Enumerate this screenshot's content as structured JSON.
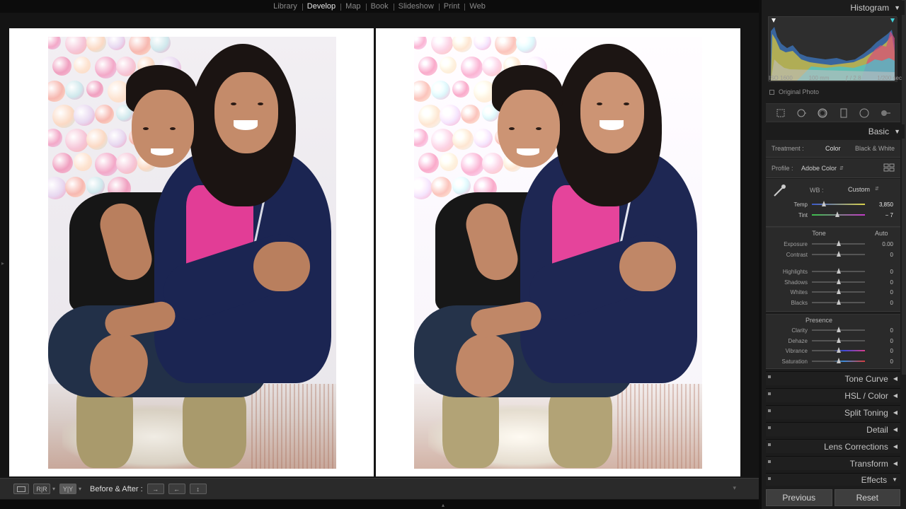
{
  "modules": [
    "Library",
    "Develop",
    "Map",
    "Book",
    "Slideshow",
    "Print",
    "Web"
  ],
  "active_module": "Develop",
  "toolbar": {
    "before_after_label": "Before & After :"
  },
  "panel": {
    "histogram_title": "Histogram",
    "iso": "ISO 1600",
    "focal": "100 mm",
    "aperture": "ƒ / 2.8",
    "shutter": "1/200 sec",
    "original_photo": "Original Photo",
    "basic_title": "Basic",
    "treatment_label": "Treatment :",
    "treatment_color": "Color",
    "treatment_bw": "Black & White",
    "profile_label": "Profile :",
    "profile_value": "Adobe Color",
    "wb_label": "WB :",
    "wb_value": "Custom",
    "tone_label": "Tone",
    "auto_label": "Auto",
    "presence_label": "Presence",
    "sliders": [
      {
        "label": "Temp",
        "value": "3,850",
        "level": 0.22,
        "track": "temp"
      },
      {
        "label": "Tint",
        "value": "− 7",
        "level": 0.48,
        "track": "tint"
      },
      {
        "label": "Exposure",
        "value": "0.00",
        "level": 0.5,
        "track": "plain"
      },
      {
        "label": "Contrast",
        "value": "0",
        "level": 0.5,
        "track": "plain"
      },
      {
        "label": "Highlights",
        "value": "0",
        "level": 0.5,
        "track": "plain"
      },
      {
        "label": "Shadows",
        "value": "0",
        "level": 0.5,
        "track": "plain"
      },
      {
        "label": "Whites",
        "value": "0",
        "level": 0.5,
        "track": "plain"
      },
      {
        "label": "Blacks",
        "value": "0",
        "level": 0.5,
        "track": "plain"
      },
      {
        "label": "Clarity",
        "value": "0",
        "level": 0.5,
        "track": "plain"
      },
      {
        "label": "Dehaze",
        "value": "0",
        "level": 0.5,
        "track": "plain"
      },
      {
        "label": "Vibrance",
        "value": "0",
        "level": 0.5,
        "track": "vib"
      },
      {
        "label": "Saturation",
        "value": "0",
        "level": 0.5,
        "track": "sat"
      }
    ],
    "collapsed_sections": [
      "Tone Curve",
      "HSL / Color",
      "Split Toning",
      "Detail",
      "Lens Corrections",
      "Transform",
      "Effects"
    ],
    "previous_label": "Previous",
    "reset_label": "Reset"
  },
  "colors": {
    "accent": "#e6e6e6",
    "panel_bg": "#2a2a2a"
  }
}
